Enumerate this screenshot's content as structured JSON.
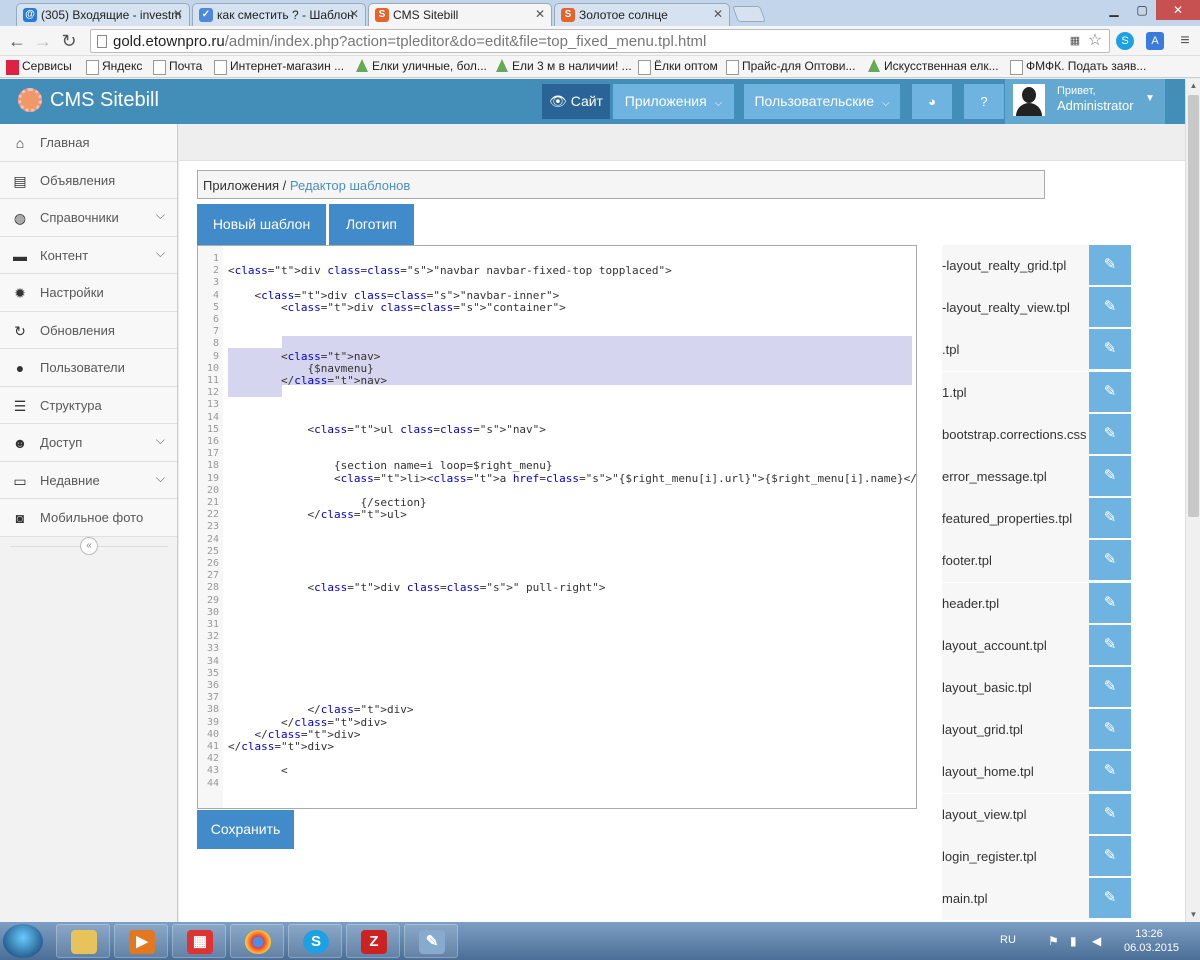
{
  "browser": {
    "tabs": [
      {
        "title": "(305) Входящие - investm",
        "color": "#2a7ad8",
        "glyph": "@"
      },
      {
        "title": "как сместить ? - Шаблон",
        "color": "#4a8ad8",
        "glyph": "✓"
      },
      {
        "title": "CMS Sitebill",
        "color": "#e8632a",
        "glyph": "S"
      },
      {
        "title": "Золотое солнце",
        "color": "#e8632a",
        "glyph": "S"
      }
    ],
    "url_domain": "gold.etownpro.ru",
    "url_path": "/admin/index.php?action=tpleditor&do=edit&file=top_fixed_menu.tpl.html",
    "bookmarks": [
      "Сервисы",
      "Яндекс",
      "Почта",
      "Интернет-магазин ...",
      "Елки уличные, бол...",
      "Ели 3 м в наличии! ...",
      "Ёлки оптом",
      "Прайс-для Оптови...",
      "Искусственная елк...",
      "ФМФК. Подать заяв..."
    ]
  },
  "header": {
    "logo": "CMS Sitebill",
    "site_label": "Сайт",
    "apps_label": "Приложения",
    "custom_label": "Пользовательские",
    "greeting": "Привет,",
    "username": "Administrator"
  },
  "sidebar": {
    "items": [
      {
        "label": "Главная",
        "icon": "home-icon",
        "glyph": "⌂",
        "chevron": false
      },
      {
        "label": "Объявления",
        "icon": "book-icon",
        "glyph": "▤",
        "chevron": false
      },
      {
        "label": "Справочники",
        "icon": "globe-icon",
        "glyph": "◍",
        "chevron": true
      },
      {
        "label": "Контент",
        "icon": "coffee-icon",
        "glyph": "▬",
        "chevron": true
      },
      {
        "label": "Настройки",
        "icon": "gear-icon",
        "glyph": "✹",
        "chevron": false
      },
      {
        "label": "Обновления",
        "icon": "refresh-icon",
        "glyph": "↻",
        "chevron": false
      },
      {
        "label": "Пользователи",
        "icon": "user-icon",
        "glyph": "●",
        "chevron": false
      },
      {
        "label": "Структура",
        "icon": "list-icon",
        "glyph": "☰",
        "chevron": false
      },
      {
        "label": "Доступ",
        "icon": "group-icon",
        "glyph": "☻",
        "chevron": true
      },
      {
        "label": "Недавние",
        "icon": "desktop-icon",
        "glyph": "▭",
        "chevron": true
      },
      {
        "label": "Мобильное фото",
        "icon": "camera-icon",
        "glyph": "◙",
        "chevron": false
      }
    ],
    "collapse_glyph": "«"
  },
  "main": {
    "breadcrumb_root": "Приложения",
    "breadcrumb_sep": " / ",
    "breadcrumb_current": "Редактор шаблонов",
    "new_template": "Новый шаблон",
    "logo_tab": "Логотип",
    "save": "Сохранить"
  },
  "editor_lines": [
    "",
    "<div class=\"navbar navbar-fixed-top topplaced\">",
    "",
    "    <div class=\"navbar-inner\">",
    "        <div class=\"container\">",
    "",
    "",
    "",
    "        <nav>",
    "            {$navmenu}",
    "        </nav>",
    "",
    "",
    "",
    "            <ul class=\"nav\">",
    "",
    "",
    "                {section name=i loop=$right_menu}",
    "                <li><a href=\"{$right_menu[i].url}\">{$right_menu[i].name}</a></li>",
    "",
    "                    {/section}",
    "            </ul>",
    "",
    "",
    "",
    "",
    "",
    "            <div class=\" pull-right\">",
    "",
    "",
    "",
    "",
    "",
    "",
    "",
    "",
    "",
    "            </div>",
    "        </div>",
    "    </div>",
    "</div>",
    "",
    "        <",
    ""
  ],
  "files": [
    "-layout_realty_grid.tpl",
    "-layout_realty_view.tpl",
    ".tpl",
    "1.tpl",
    "bootstrap.corrections.css",
    "error_message.tpl",
    "featured_properties.tpl",
    "footer.tpl",
    "header.tpl",
    "layout_account.tpl",
    "layout_basic.tpl",
    "layout_grid.tpl",
    "layout_home.tpl",
    "layout_view.tpl",
    "login_register.tpl",
    "main.tpl"
  ],
  "taskbar": {
    "lang": "RU",
    "time": "13:26",
    "date": "06.03.2015"
  }
}
